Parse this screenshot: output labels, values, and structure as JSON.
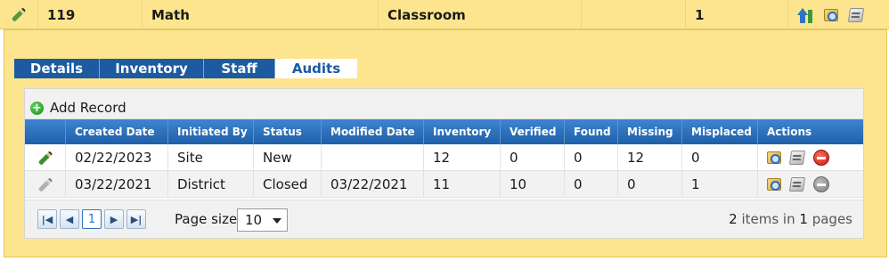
{
  "parent_row": {
    "id": "119",
    "subject": "Math",
    "type": "Classroom",
    "count": "1",
    "icons": [
      "pencil-icon",
      "sort-icon",
      "view-icon",
      "print-icon"
    ]
  },
  "tabs": [
    {
      "label": "Details"
    },
    {
      "label": "Inventory"
    },
    {
      "label": "Staff"
    },
    {
      "label": "Audits"
    }
  ],
  "audits": {
    "add_record_label": "Add Record",
    "columns": [
      "Created Date",
      "Initiated By",
      "Status",
      "Modified Date",
      "Inventory",
      "Verified",
      "Found",
      "Missing",
      "Misplaced",
      "Actions"
    ],
    "rows": [
      {
        "created": "02/22/2023",
        "initiated_by": "Site",
        "status": "New",
        "modified": "",
        "inventory": "12",
        "verified": "0",
        "found": "0",
        "missing": "12",
        "misplaced": "0",
        "delete_enabled": true
      },
      {
        "created": "03/22/2021",
        "initiated_by": "District",
        "status": "Closed",
        "modified": "03/22/2021",
        "inventory": "11",
        "verified": "10",
        "found": "0",
        "missing": "0",
        "misplaced": "1",
        "delete_enabled": false
      }
    ]
  },
  "pager": {
    "current_page": "1",
    "page_size_label": "Page size:",
    "page_size": "10",
    "info_items": "2",
    "info_items_text": "items in",
    "info_pages": "1",
    "info_pages_text": "pages"
  },
  "colors": {
    "row_highlight": "#fde58f",
    "header_blue": "#1e5fa8",
    "tab_blue": "#1d5aa0"
  }
}
